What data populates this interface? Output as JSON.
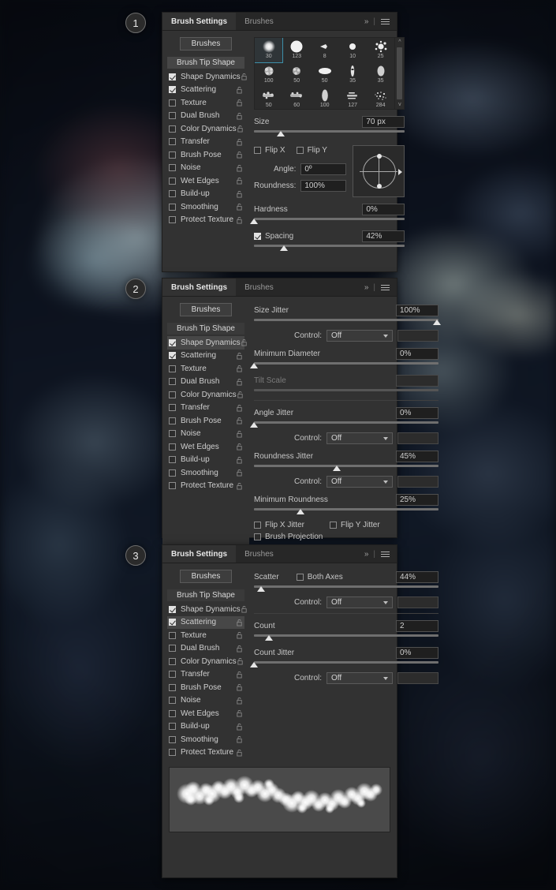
{
  "steps": [
    "1",
    "2",
    "3"
  ],
  "panel": {
    "tabs": [
      {
        "label": "Brush Settings",
        "active": true
      },
      {
        "label": "Brushes",
        "active": false
      }
    ],
    "header_icons": {
      "collapse": "»",
      "separator": "|",
      "menu": "menu-icon"
    },
    "brushes_button": "Brushes",
    "options": {
      "header": "Brush Tip Shape",
      "items": [
        {
          "label": "Shape Dynamics",
          "checked": true
        },
        {
          "label": "Scattering",
          "checked": true
        },
        {
          "label": "Texture",
          "checked": false
        },
        {
          "label": "Dual Brush",
          "checked": false
        },
        {
          "label": "Color Dynamics",
          "checked": false
        },
        {
          "label": "Transfer",
          "checked": false
        },
        {
          "label": "Brush Pose",
          "checked": false
        },
        {
          "label": "Noise",
          "checked": false
        },
        {
          "label": "Wet Edges",
          "checked": false
        },
        {
          "label": "Build-up",
          "checked": false
        },
        {
          "label": "Smoothing",
          "checked": false
        },
        {
          "label": "Protect Texture",
          "checked": false
        }
      ]
    }
  },
  "panel1": {
    "selected_option": "Brush Tip Shape",
    "presets": [
      {
        "size": "30",
        "shape": "soft-round",
        "selected": true
      },
      {
        "size": "123",
        "shape": "hard-round",
        "selected": false
      },
      {
        "size": "8",
        "shape": "flat-angled",
        "selected": false
      },
      {
        "size": "10",
        "shape": "small-round",
        "selected": false
      },
      {
        "size": "25",
        "shape": "splatter",
        "selected": false
      },
      {
        "size": "100",
        "shape": "rough-round",
        "selected": false
      },
      {
        "size": "50",
        "shape": "rough-round",
        "selected": false
      },
      {
        "size": "50",
        "shape": "oval-soft",
        "selected": false
      },
      {
        "size": "35",
        "shape": "narrow-rough",
        "selected": false
      },
      {
        "size": "35",
        "shape": "oval-blur",
        "selected": false
      },
      {
        "size": "50",
        "shape": "chalk",
        "selected": false
      },
      {
        "size": "60",
        "shape": "chalk",
        "selected": false
      },
      {
        "size": "100",
        "shape": "oval-solid",
        "selected": false
      },
      {
        "size": "127",
        "shape": "dry-brush",
        "selected": false
      },
      {
        "size": "284",
        "shape": "spatter-spray",
        "selected": false
      },
      {
        "size": "",
        "shape": "dots-scatter",
        "selected": false
      },
      {
        "size": "",
        "shape": "streak",
        "selected": false
      },
      {
        "size": "",
        "shape": "grass",
        "selected": false
      },
      {
        "size": "",
        "shape": "splash",
        "selected": false
      },
      {
        "size": "",
        "shape": "soft-oval",
        "selected": false
      }
    ],
    "size": {
      "label": "Size",
      "value": "70 px",
      "percent": 18
    },
    "flip_x": {
      "label": "Flip X",
      "checked": false
    },
    "flip_y": {
      "label": "Flip Y",
      "checked": false
    },
    "angle": {
      "label": "Angle:",
      "value": "0º"
    },
    "roundness": {
      "label": "Roundness:",
      "value": "100%"
    },
    "hardness": {
      "label": "Hardness",
      "value": "0%",
      "percent": 0
    },
    "spacing": {
      "label": "Spacing",
      "value": "42%",
      "checked": true,
      "percent": 20
    }
  },
  "panel2": {
    "selected_option": "Shape Dynamics",
    "size_jitter": {
      "label": "Size Jitter",
      "value": "100%",
      "percent": 100
    },
    "control1": {
      "label": "Control:",
      "value": "Off"
    },
    "minimum_diameter": {
      "label": "Minimum Diameter",
      "value": "0%",
      "percent": 0
    },
    "tilt_scale": {
      "label": "Tilt Scale",
      "value": "",
      "percent": 0,
      "disabled": true
    },
    "angle_jitter": {
      "label": "Angle Jitter",
      "value": "0%",
      "percent": 0
    },
    "control2": {
      "label": "Control:",
      "value": "Off"
    },
    "roundness_jitter": {
      "label": "Roundness Jitter",
      "value": "45%",
      "percent": 45
    },
    "control3": {
      "label": "Control:",
      "value": "Off"
    },
    "minimum_roundness": {
      "label": "Minimum Roundness",
      "value": "25%",
      "percent": 25
    },
    "flip_x_jitter": {
      "label": "Flip X Jitter",
      "checked": false
    },
    "flip_y_jitter": {
      "label": "Flip Y Jitter",
      "checked": false
    },
    "brush_projection": {
      "label": "Brush Projection",
      "checked": false
    }
  },
  "panel3": {
    "selected_option": "Scattering",
    "scatter": {
      "label": "Scatter",
      "value": "44%",
      "percent": 4
    },
    "both_axes": {
      "label": "Both Axes",
      "checked": false
    },
    "control1": {
      "label": "Control:",
      "value": "Off"
    },
    "count": {
      "label": "Count",
      "value": "2",
      "percent": 8
    },
    "count_jitter": {
      "label": "Count Jitter",
      "value": "0%",
      "percent": 0
    },
    "control2": {
      "label": "Control:",
      "value": "Off"
    },
    "preview": {
      "name": "brush-stroke-preview"
    }
  }
}
